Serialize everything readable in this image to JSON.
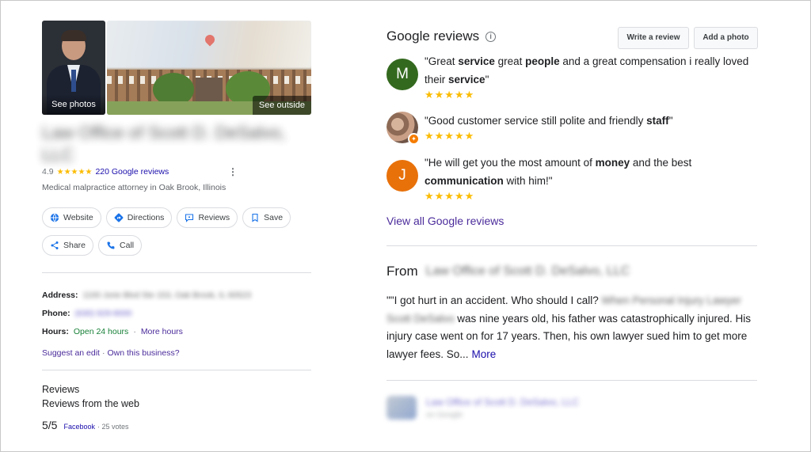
{
  "left": {
    "photos": {
      "see_photos": "See photos",
      "see_outside": "See outside"
    },
    "business_name": "Law Office of Scott D. DeSalvo, LLC",
    "rating": {
      "value": "4.9",
      "stars": "★★★★★",
      "reviews_link": "220 Google reviews"
    },
    "category": "Medical malpractice attorney in Oak Brook, Illinois",
    "buttons": {
      "website": "Website",
      "directions": "Directions",
      "reviews": "Reviews",
      "save": "Save",
      "share": "Share",
      "call": "Call"
    },
    "info": {
      "address_label": "Address:",
      "address_value": "1100 Jorie Blvd Ste 153, Oak Brook, IL 60523",
      "phone_label": "Phone:",
      "phone_value": "(630) 929-9000",
      "hours_label": "Hours:",
      "hours_status": "Open 24 hours",
      "hours_sep": "·",
      "more_hours": "More hours",
      "suggest_edit": "Suggest an edit",
      "own_sep": "·",
      "own_business": "Own this business?"
    },
    "reviews_section": {
      "heading": "Reviews",
      "from_web": "Reviews from the web",
      "score": "5/5",
      "source": "Facebook",
      "votes": "· 25 votes"
    }
  },
  "right": {
    "title": "Google reviews",
    "info_icon": "i",
    "write_review": "Write a review",
    "add_photo": "Add a photo",
    "reviews": [
      {
        "avatar_letter": "M",
        "avatar_color": "#33691e",
        "q_open": "\"Great ",
        "b1": "service",
        "t1": " great ",
        "b2": "people",
        "t2": " and a great compensation i really loved their ",
        "b3": "service",
        "q_close": "\"",
        "stars": "★★★★★"
      },
      {
        "q_open": "\"Good customer service still polite and friendly ",
        "b1": "staff",
        "q_close": "\"",
        "stars": "★★★★★"
      },
      {
        "avatar_letter": "J",
        "avatar_color": "#e8710a",
        "q_open": "\"He will get you the most amount of ",
        "b1": "money",
        "t1": " and the best ",
        "b2": "communication",
        "q_close": " with him!\"",
        "stars": "★★★★★"
      }
    ],
    "view_all": "View all Google reviews",
    "from_label": "From",
    "from_name": "Law Office of Scott D. DeSalvo, LLC",
    "from_text_1": "\"\"I got hurt in an accident. Who should I call?",
    "from_blurred": "When Personal Injury Lawyer Scott DeSalvo",
    "from_text_2": " was nine years old, his father was catastrophically injured. His injury case went on for 17 years. Then, his own lawyer sued him to get more lawyer fees. So...",
    "more": "More",
    "footer_name": "Law Office of Scott D. DeSalvo, LLC",
    "footer_sub": "on Google"
  },
  "colors": {
    "star": "#fbbc04",
    "link": "#1a0dab",
    "visited": "#4b2c9b",
    "open_green": "#188038"
  }
}
